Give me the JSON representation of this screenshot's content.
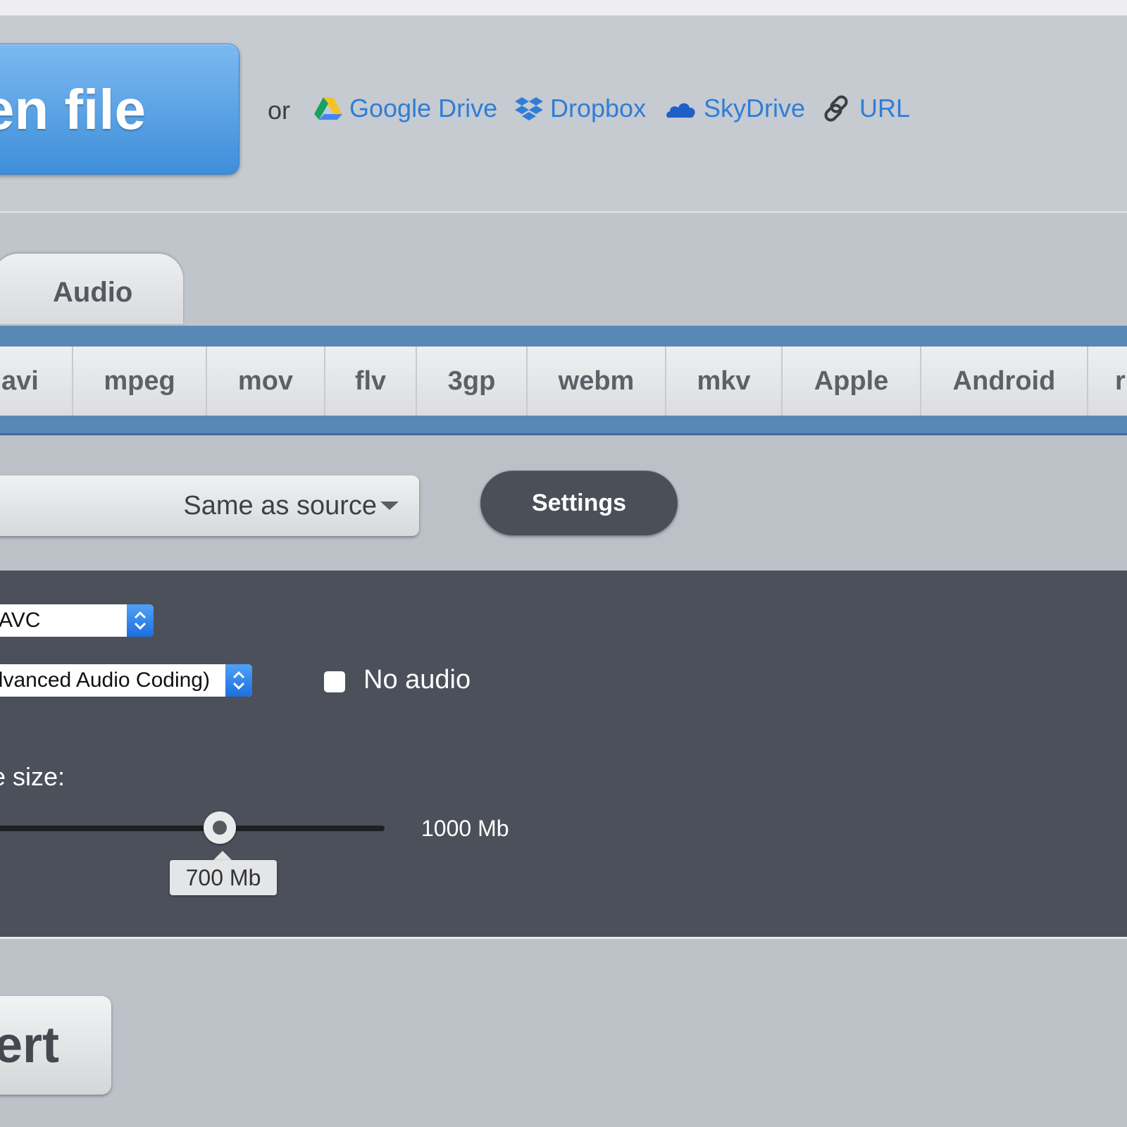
{
  "open": {
    "label": "en file"
  },
  "sources": {
    "or_label": "or",
    "items": [
      {
        "label": "Google Drive",
        "icon": "google-drive-icon"
      },
      {
        "label": "Dropbox",
        "icon": "dropbox-icon"
      },
      {
        "label": "SkyDrive",
        "icon": "skydrive-icon"
      },
      {
        "label": "URL",
        "icon": "link-icon"
      }
    ],
    "link_color": "#2f7ed6"
  },
  "tabs": {
    "audio": "Audio"
  },
  "formats": [
    "avi",
    "mpeg",
    "mov",
    "flv",
    "3gp",
    "webm",
    "mkv",
    "Apple",
    "Android",
    "r"
  ],
  "resolution": {
    "value": "Same as source"
  },
  "settings": {
    "label": "Settings"
  },
  "advanced": {
    "video_codec": "AVC",
    "audio_codec": "lvanced Audio Coding)",
    "no_audio_label": "No audio",
    "no_audio_checked": false,
    "size_label": "e size:",
    "size_value": "700 Mb",
    "size_max": "1000 Mb"
  },
  "convert": {
    "label": "ert"
  },
  "colors": {
    "accent_blue": "#3f8edb",
    "frame_blue": "#5a88b6",
    "panel_dark": "#4b505a"
  }
}
